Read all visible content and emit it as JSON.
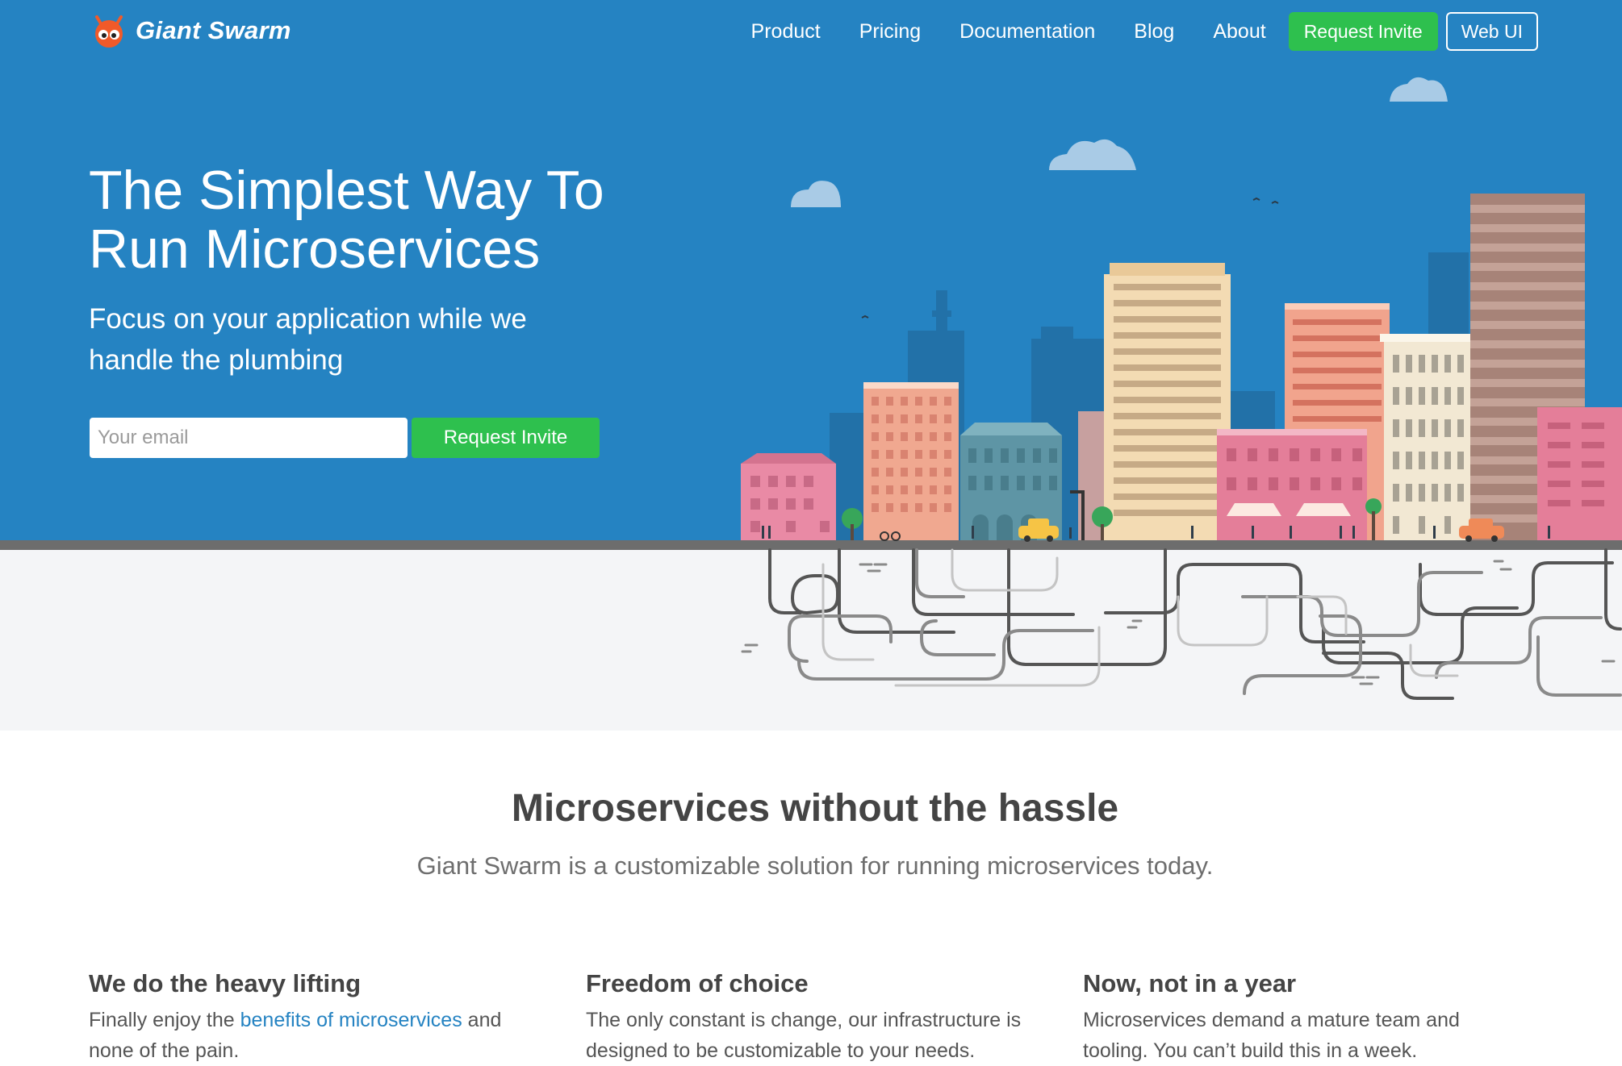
{
  "header": {
    "brand": "Giant Swarm",
    "nav": [
      "Product",
      "Pricing",
      "Documentation",
      "Blog",
      "About"
    ],
    "request_invite_label": "Request Invite",
    "web_ui_label": "Web UI"
  },
  "hero": {
    "title": "The Simplest Way To Run Microservices",
    "subtitle": "Focus on your application while we handle the plumbing",
    "email_placeholder": "Your email",
    "cta_label": "Request Invite"
  },
  "section": {
    "title": "Microservices without the hassle",
    "subtitle": "Giant Swarm is a customizable solution for running microservices today."
  },
  "features": [
    {
      "title": "We do the heavy lifting",
      "text_before": "Finally enjoy the ",
      "link": "benefits of microservices",
      "text_after": " and none of the pain."
    },
    {
      "title": "Freedom of choice",
      "text": "The only constant is change, our infrastructure is designed to be customizable to your needs."
    },
    {
      "title": "Now, not in a year",
      "text": "Microservices demand a mature team and tooling. You can’t build this in a week."
    }
  ],
  "colors": {
    "hero_blue": "#2583c2",
    "accent_green": "#2ec04e",
    "heading_gray": "#444444",
    "link_blue": "#2583c2"
  },
  "icons": {
    "logo": "ant-mascot-icon"
  }
}
